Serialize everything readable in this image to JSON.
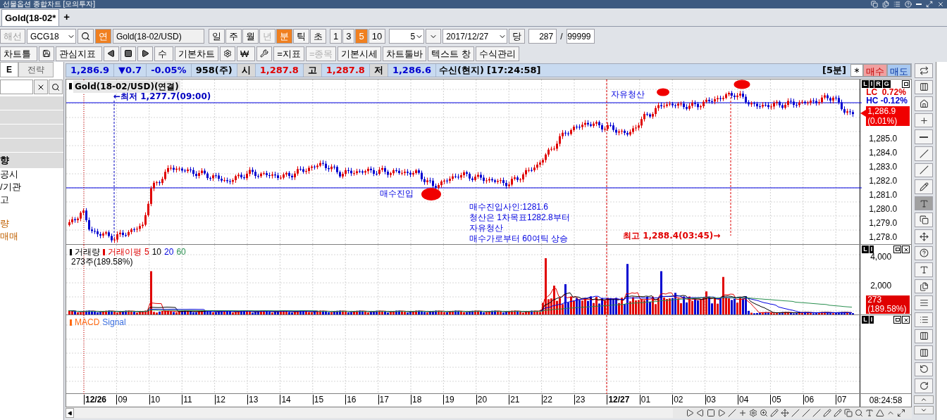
{
  "window": {
    "title": "선물옵션 종합차트 [모의투자]"
  },
  "tabs": [
    {
      "label": "Gold(18-02*",
      "selected": true
    }
  ],
  "add_tab": "+",
  "toolbar": {
    "market": {
      "label": "해선",
      "disabled": true
    },
    "code": "GCG18",
    "link_button": "연",
    "name": "Gold(18-02/USD)",
    "periods": [
      {
        "label": "일",
        "selected": false,
        "disabled": false
      },
      {
        "label": "주",
        "selected": false,
        "disabled": false
      },
      {
        "label": "월",
        "selected": false,
        "disabled": false
      },
      {
        "label": "년",
        "selected": false,
        "disabled": true
      },
      {
        "label": "분",
        "selected": true,
        "disabled": false
      },
      {
        "label": "틱",
        "selected": false,
        "disabled": false
      },
      {
        "label": "초",
        "selected": false,
        "disabled": false
      }
    ],
    "intervals": [
      {
        "label": "1",
        "selected": false
      },
      {
        "label": "3",
        "selected": false
      },
      {
        "label": "5",
        "selected": true
      },
      {
        "label": "10",
        "selected": false
      }
    ],
    "interval_value": "5",
    "date": "2017/12/27",
    "current_button": "당",
    "count": "287",
    "separator": "/",
    "max_count": "99999"
  },
  "toolbar2": [
    {
      "kind": "menu",
      "label": "차트틀",
      "disabled": false
    },
    {
      "kind": "save"
    },
    {
      "kind": "menu",
      "label": "관심지표",
      "disabled": false
    },
    {
      "kind": "prev"
    },
    {
      "kind": "stop"
    },
    {
      "kind": "next"
    },
    {
      "kind": "menu",
      "label": "수",
      "disabled": false
    },
    {
      "kind": "button",
      "label": "기본차트",
      "disabled": false
    },
    {
      "kind": "tool"
    },
    {
      "kind": "menu",
      "label": "₩",
      "disabled": false
    },
    {
      "kind": "wrench"
    },
    {
      "kind": "button",
      "label": "=지표",
      "disabled": false
    },
    {
      "kind": "button",
      "label": "=종목",
      "disabled": true
    },
    {
      "kind": "button",
      "label": "기본시세",
      "disabled": false
    },
    {
      "kind": "button",
      "label": "차트툴바",
      "disabled": false
    },
    {
      "kind": "button",
      "label": "텍스트 창",
      "disabled": false
    },
    {
      "kind": "button",
      "label": "수식관리",
      "disabled": false
    }
  ],
  "left_panel": {
    "tabs": [
      {
        "label": "E",
        "selected": true
      },
      {
        "label": "전략",
        "selected": false
      }
    ],
    "rows": [
      {
        "kind": "blank"
      },
      {
        "kind": "blank"
      },
      {
        "kind": "blank"
      },
      {
        "kind": "blank"
      },
      {
        "kind": "header",
        "label": "향"
      },
      {
        "kind": "item",
        "label": "공시",
        "highlighted": false
      },
      {
        "kind": "item",
        "label": "/기관",
        "highlighted": false
      },
      {
        "kind": "item",
        "label": "고",
        "highlighted": false
      },
      {
        "kind": "spacer"
      },
      {
        "kind": "item",
        "label": "량",
        "highlighted": true
      },
      {
        "kind": "item",
        "label": "매매",
        "highlighted": true
      }
    ]
  },
  "info_bar": {
    "values": [
      {
        "text": "1,286.9",
        "kind": "value",
        "color": "#0000d0"
      },
      {
        "text": "▼0.7",
        "kind": "value",
        "color": "#0000d0"
      },
      {
        "text": "-0.05%",
        "kind": "value",
        "color": "#0000d0"
      },
      {
        "text": "958(주)",
        "kind": "value",
        "color": "#000000"
      },
      {
        "text": "시",
        "kind": "label",
        "color": "#000000"
      },
      {
        "text": "1,287.8",
        "kind": "value",
        "color": "#e00000"
      },
      {
        "text": "고",
        "kind": "label",
        "color": "#000000"
      },
      {
        "text": "1,287.8",
        "kind": "value",
        "color": "#e00000"
      },
      {
        "text": "저",
        "kind": "label",
        "color": "#000000"
      },
      {
        "text": "1,286.6",
        "kind": "value",
        "color": "#0000d0"
      }
    ],
    "feed": "수신(현지)",
    "time": "[17:24:58]",
    "period": "[5분]",
    "buy": "매수",
    "sell": "매도"
  },
  "price_pane": {
    "title": "Gold(18-02/USD)(연결)",
    "letters": [
      "L",
      "I",
      "R",
      "G"
    ],
    "stats": [
      {
        "text": "LC  0.72%",
        "color": "#e00000"
      },
      {
        "text": "HC -0.12%",
        "color": "#0000d0"
      }
    ],
    "price_tag": [
      "1,286.9",
      "(0.01%)"
    ],
    "yticks": [
      "1,285.0",
      "1,284.0",
      "1,283.0",
      "1,282.0",
      "1,281.0",
      "1,280.0",
      "1,279.0",
      "1,278.0"
    ],
    "annotations": [
      {
        "kind": "low",
        "text": "←최저 1,277.7(09:00)"
      },
      {
        "kind": "exit",
        "text": "자유청산"
      },
      {
        "kind": "entry",
        "text": "매수진입"
      },
      {
        "kind": "note",
        "lines": [
          "매수진입사인:1281.6",
          "청산은 1차목표1282.8부터",
          "자유청산",
          "매수가로부터 60여틱 상승"
        ]
      },
      {
        "kind": "high",
        "text": "최고 1,288.4(03:45)→"
      }
    ]
  },
  "volume_pane": {
    "letters": [
      "L",
      "I"
    ],
    "legend": [
      {
        "text": "거래량",
        "color": "#000000",
        "marker": true
      },
      {
        "text": "거래이평",
        "color": "#e00000",
        "marker": true
      },
      {
        "text": "5",
        "color": "#e00000",
        "marker": false
      },
      {
        "text": "10",
        "color": "#000000",
        "marker": false
      },
      {
        "text": "20",
        "color": "#0000e0",
        "marker": false
      },
      {
        "text": "60",
        "color": "#2a9050",
        "marker": false
      }
    ],
    "value": "273주(189.58%)",
    "yticks": [
      "4,000",
      "2,000"
    ],
    "tag": [
      "273",
      "(189.58%)"
    ]
  },
  "macd_pane": {
    "letters": [
      "L",
      "I"
    ],
    "legend": [
      {
        "text": "MACD",
        "color": "#ff6a13",
        "marker": true
      },
      {
        "text": "Signal",
        "color": "#3b6fe0",
        "marker": false
      }
    ]
  },
  "x_axis": {
    "labels": [
      {
        "text": "12/26",
        "bold": true
      },
      {
        "text": "09",
        "bold": false
      },
      {
        "text": "10",
        "bold": false
      },
      {
        "text": "11",
        "bold": false
      },
      {
        "text": "12",
        "bold": false
      },
      {
        "text": "13",
        "bold": false
      },
      {
        "text": "14",
        "bold": false
      },
      {
        "text": "15",
        "bold": false
      },
      {
        "text": "16",
        "bold": false
      },
      {
        "text": "17",
        "bold": false
      },
      {
        "text": "18",
        "bold": false
      },
      {
        "text": "19",
        "bold": false
      },
      {
        "text": "20",
        "bold": false
      },
      {
        "text": "21",
        "bold": false
      },
      {
        "text": "22",
        "bold": false
      },
      {
        "text": "23",
        "bold": false
      },
      {
        "text": "12/27",
        "bold": true
      },
      {
        "text": "01",
        "bold": false
      },
      {
        "text": "02",
        "bold": false
      },
      {
        "text": "03",
        "bold": false
      },
      {
        "text": "04",
        "bold": false
      },
      {
        "text": "05",
        "bold": false
      },
      {
        "text": "06",
        "bold": false
      },
      {
        "text": "07",
        "bold": false
      }
    ],
    "time": "08:24:58"
  }
}
